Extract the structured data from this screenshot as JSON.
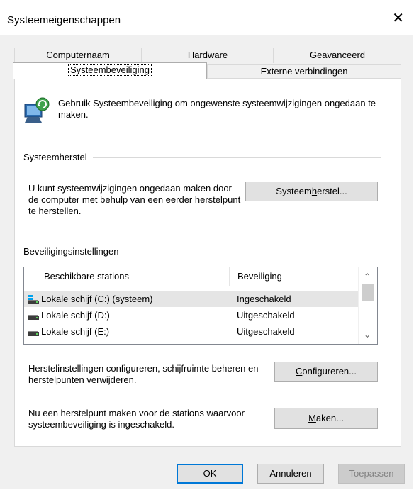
{
  "window": {
    "title": "Systeemeigenschappen",
    "close_glyph": "✕"
  },
  "tabs_row1": [
    "Computernaam",
    "Hardware",
    "Geavanceerd"
  ],
  "tabs_row2": [
    "Systeembeveiliging",
    "Externe verbindingen"
  ],
  "selected_tab": "Systeembeveiliging",
  "intro": {
    "icon": "system-protection-icon",
    "text": "Gebruik Systeembeveiliging om ongewenste systeemwijzigingen ongedaan te maken."
  },
  "restore": {
    "group_title": "Systeemherstel",
    "description": "U kunt systeemwijzigingen ongedaan maken door de computer met behulp van een eerder herstelpunt te herstellen.",
    "button_pre": "Systeem",
    "button_key": "h",
    "button_post": "erstel..."
  },
  "protection": {
    "group_title": "Beveiligingsinstellingen",
    "columns": [
      "Beschikbare stations",
      "Beveiliging"
    ],
    "rows": [
      {
        "name": "Lokale schijf (C:) (systeem)",
        "status": "Ingeschakeld",
        "icon": "system-drive-icon"
      },
      {
        "name": "Lokale schijf (D:)",
        "status": "Uitgeschakeld",
        "icon": "drive-icon"
      },
      {
        "name": "Lokale schijf (E:)",
        "status": "Uitgeschakeld",
        "icon": "drive-icon"
      }
    ],
    "configure_text": "Herstelinstellingen configureren, schijfruimte beheren en herstelpunten verwijderen.",
    "configure_pre": "",
    "configure_key": "C",
    "configure_post": "onfigureren...",
    "create_text": "Nu een herstelpunt maken voor de stations waarvoor systeembeveiliging is ingeschakeld.",
    "create_pre": "",
    "create_key": "M",
    "create_post": "aken..."
  },
  "footer": {
    "ok": "OK",
    "cancel": "Annuleren",
    "apply": "Toepassen"
  },
  "colors": {
    "accent": "#0078d7",
    "selection": "#e5e5e5",
    "dialog_bg": "#f0f0f0"
  }
}
